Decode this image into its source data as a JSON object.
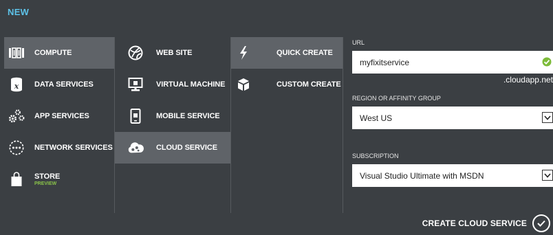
{
  "dialog": {
    "title": "NEW"
  },
  "categories": [
    {
      "label": "COMPUTE",
      "icon": "compute-icon",
      "selected": true
    },
    {
      "label": "DATA SERVICES",
      "icon": "data-services-icon"
    },
    {
      "label": "APP SERVICES",
      "icon": "app-services-icon"
    },
    {
      "label": "NETWORK SERVICES",
      "icon": "network-services-icon"
    },
    {
      "label": "STORE",
      "sublabel": "PREVIEW",
      "icon": "store-icon"
    }
  ],
  "services": [
    {
      "label": "WEB SITE",
      "icon": "web-site-icon"
    },
    {
      "label": "VIRTUAL MACHINE",
      "icon": "virtual-machine-icon"
    },
    {
      "label": "MOBILE SERVICE",
      "icon": "mobile-service-icon"
    },
    {
      "label": "CLOUD SERVICE",
      "icon": "cloud-service-icon",
      "selected": true
    }
  ],
  "create_options": [
    {
      "label": "QUICK CREATE",
      "icon": "lightning-icon",
      "selected": true
    },
    {
      "label": "CUSTOM CREATE",
      "icon": "box-icon"
    }
  ],
  "form": {
    "url_label": "URL",
    "url_value": "myfixitservice",
    "url_suffix": ".cloudapp.net",
    "region_label": "REGION OR AFFINITY GROUP",
    "region_value": "West US",
    "subscription_label": "SUBSCRIPTION",
    "subscription_value": "Visual Studio Ultimate with MSDN"
  },
  "footer": {
    "create_label": "CREATE CLOUD SERVICE"
  },
  "colors": {
    "background": "#3b3f43",
    "selected": "#5f6368",
    "title_accent": "#5dc2e8",
    "preview_green": "#8ac44a",
    "valid_check": "#7dbb3a"
  }
}
